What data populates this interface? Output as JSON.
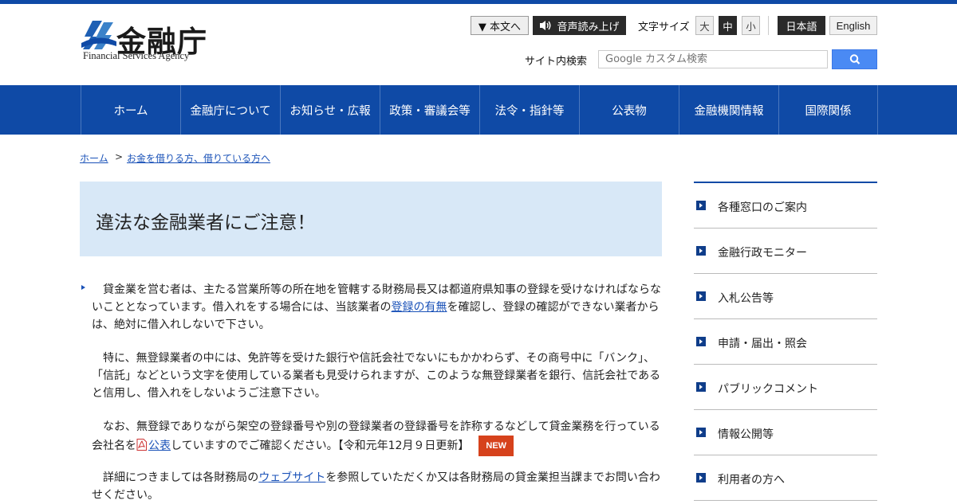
{
  "logo": {
    "name_jp": "金融庁",
    "name_en": "Financial Services Agency"
  },
  "utility": {
    "skip_label": "▼ 本文へ",
    "voice_label": "音声読み上げ",
    "font_size_label": "文字サイズ",
    "font_sizes": [
      "大",
      "中",
      "小"
    ],
    "selected_font_size": "中",
    "lang_ja": "日本語",
    "lang_en": "English"
  },
  "search": {
    "label": "サイト内検索",
    "placeholder": "Google カスタム検索"
  },
  "nav": [
    "ホーム",
    "金融庁について",
    "お知らせ・広報",
    "政策・審議会等",
    "法令・指針等",
    "公表物",
    "金融機関情報",
    "国際関係"
  ],
  "breadcrumb": {
    "home": "ホーム",
    "separator": ">",
    "current": "お金を借りる方、借りている方へ"
  },
  "page_title": "違法な金融業者にご注意！",
  "content": {
    "p1_a": "　貸金業を営む者は、主たる営業所等の所在地を管轄する財務局長又は都道府県知事の登録を受けなければならないこととなっています。借入れをする場合には、当該業者の",
    "p1_link": "登録の有無",
    "p1_b": "を確認し、登録の確認ができない業者からは、絶対に借入れしないで下さい。",
    "p2": "　特に、無登録業者の中には、免許等を受けた銀行や信託会社でないにもかかわらず、その商号中に「バンク」、「信託」などという文字を使用している業者も見受けられますが、このような無登録業者を銀行、信託会社であると信用し、借入れをしないようご注意下さい。",
    "p3_a": "　なお、無登録でありながら架空の登録番号や別の登録業者の登録番号を詐称するなどして貸金業務を行っている会社名を",
    "p3_link": "公表",
    "p3_b": "していますのでご確認ください。【令和元年12月９日更新】",
    "new_badge": "NEW",
    "p4_a": "　詳細につきましては各財務局の",
    "p4_link": "ウェブサイト",
    "p4_b": "を参照していただくか又は各財務局の貸金業担当課までお問い合わせください。"
  },
  "side_menu": [
    "各種窓口のご案内",
    "金融行政モニター",
    "入札公告等",
    "申請・届出・照会",
    "パブリックコメント",
    "情報公開等",
    "利用者の方へ"
  ],
  "colors": {
    "brand_blue": "#0f4aa6",
    "title_bg": "#d8e8f7",
    "new_badge": "#d6421c",
    "search_button": "#4a8af4"
  }
}
